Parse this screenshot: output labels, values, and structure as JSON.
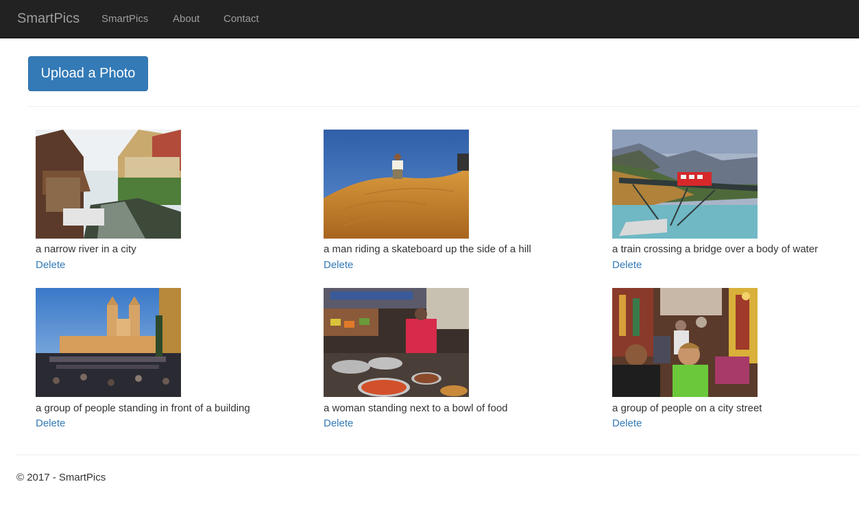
{
  "navbar": {
    "brand": "SmartPics",
    "links": [
      "SmartPics",
      "About",
      "Contact"
    ]
  },
  "upload_button_label": "Upload a Photo",
  "photos": [
    {
      "caption": "a narrow river in a city",
      "delete_label": "Delete",
      "image": "canal-town-photo"
    },
    {
      "caption": "a man riding a skateboard up the side of a hill",
      "delete_label": "Delete",
      "image": "desert-sand-photo"
    },
    {
      "caption": "a train crossing a bridge over a body of water",
      "delete_label": "Delete",
      "image": "mountain-train-bridge-photo"
    },
    {
      "caption": "a group of people standing in front of a building",
      "delete_label": "Delete",
      "image": "church-steps-photo"
    },
    {
      "caption": "a woman standing next to a bowl of food",
      "delete_label": "Delete",
      "image": "food-market-photo"
    },
    {
      "caption": "a group of people on a city street",
      "delete_label": "Delete",
      "image": "bazaar-street-photo"
    }
  ],
  "footer": "© 2017 - SmartPics",
  "colors": {
    "navbar": "#222222",
    "link": "#337ab7",
    "primary_button": "#337ab7"
  }
}
